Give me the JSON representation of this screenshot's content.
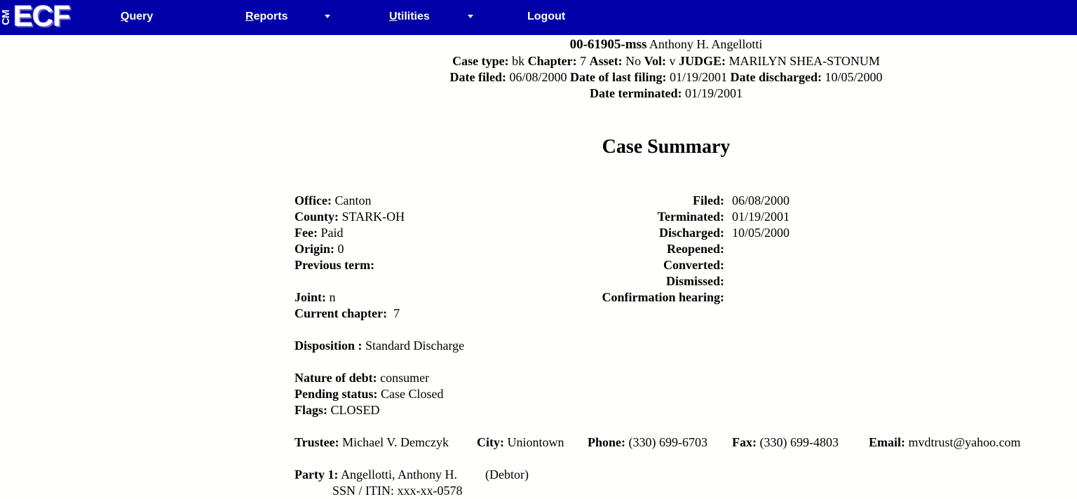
{
  "nav": {
    "logo_cm": "CM",
    "logo_ecf": "ECF",
    "query": {
      "first": "Q",
      "rest": "uery"
    },
    "reports": {
      "first": "R",
      "rest": "eports"
    },
    "utilities": {
      "first": "U",
      "rest": "tilities"
    },
    "logout": "Logout",
    "dropdown_icon": "caret-down"
  },
  "header": {
    "case_number": "00-61905-mss",
    "debtor_name": "Anthony H. Angellotti",
    "case_type_label": "Case type:",
    "case_type": "bk",
    "chapter_label": "Chapter:",
    "chapter": "7",
    "asset_label": "Asset:",
    "asset": "No",
    "vol_label": "Vol:",
    "vol": "v",
    "judge_label": "JUDGE:",
    "judge": "MARILYN SHEA-STONUM",
    "date_filed_label": "Date filed:",
    "date_filed": "06/08/2000",
    "last_filing_label": "Date of last filing:",
    "last_filing": "01/19/2001",
    "discharged_label": "Date discharged:",
    "discharged": "10/05/2000",
    "terminated_label": "Date terminated:",
    "terminated": "01/19/2001"
  },
  "summary_title": "Case Summary",
  "left": {
    "office_label": "Office:",
    "office": "Canton",
    "county_label": "County:",
    "county": "STARK-OH",
    "fee_label": "Fee:",
    "fee": "Paid",
    "origin_label": "Origin:",
    "origin": "0",
    "previous_term_label": "Previous term:",
    "joint_label": "Joint:",
    "joint": "n",
    "current_chapter_label": "Current chapter:",
    "current_chapter": "7",
    "disposition_label": "Disposition :",
    "disposition": "Standard Discharge",
    "nature_label": "Nature of debt:",
    "nature": "consumer",
    "pending_label": "Pending status:",
    "pending": "Case Closed",
    "flags_label": "Flags:",
    "flags": "CLOSED"
  },
  "right": {
    "filed_label": "Filed:",
    "filed": "06/08/2000",
    "terminated_label": "Terminated:",
    "terminated": "01/19/2001",
    "discharged_label": "Discharged:",
    "discharged": "10/05/2000",
    "reopened_label": "Reopened:",
    "converted_label": "Converted:",
    "dismissed_label": "Dismissed:",
    "confirmation_label": "Confirmation hearing:"
  },
  "trustee": {
    "trustee_label": "Trustee:",
    "trustee": "Michael V. Demczyk",
    "city_label": "City:",
    "city": "Uniontown",
    "phone_label": "Phone:",
    "phone": "(330) 699-6703",
    "fax_label": "Fax:",
    "fax": "(330) 699-4803",
    "email_label": "Email:",
    "email": "mvdtrust@yahoo.com"
  },
  "party": {
    "label": "Party 1:",
    "name": "Angellotti, Anthony H.",
    "role": "(Debtor)",
    "ssn": "SSN / ITIN: xxx-xx-0578"
  }
}
